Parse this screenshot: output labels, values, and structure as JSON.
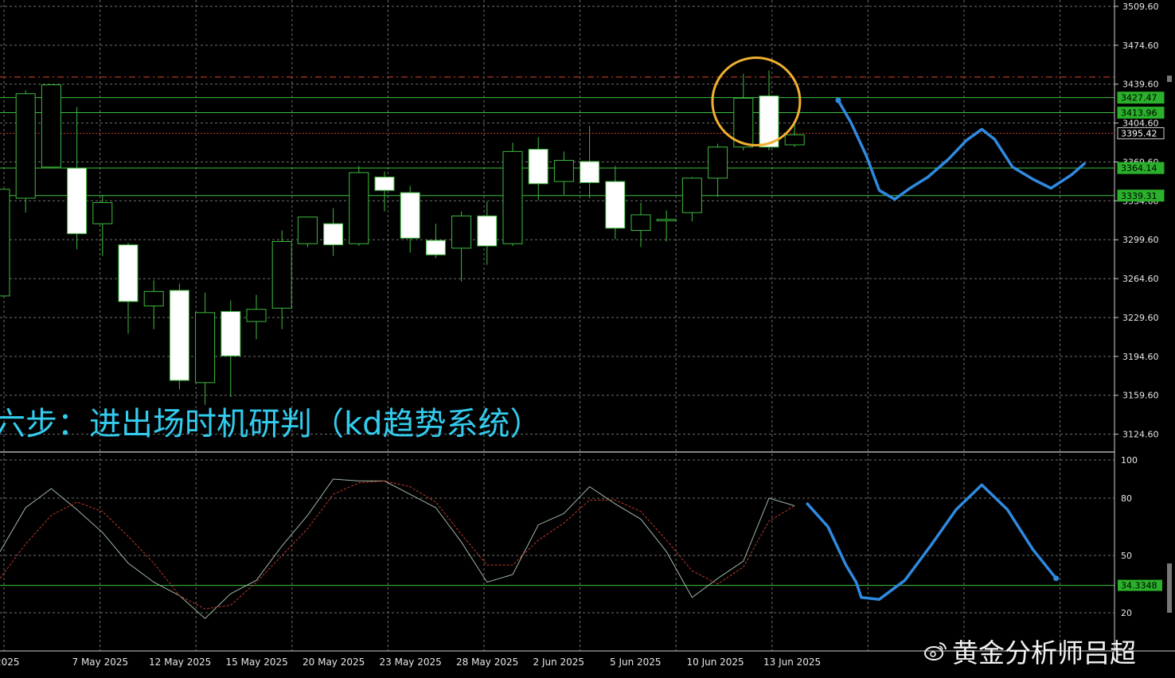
{
  "overlay_title": "六步：进出场时机研判（kd趋势系统）",
  "watermark": "黄金分析师吕超",
  "colors": {
    "background": "#000000",
    "grid": "#6e6e6e",
    "candle_up_fill": "#000000",
    "candle_down_fill": "#ffffff",
    "candle_outline": "#3dbb3d",
    "level_line": "#3cbf3c",
    "resistance_line": "#c03a2a",
    "k_line": "#9fb6a8",
    "d_line": "#c0392b",
    "annotation_blue": "#2f8ae0",
    "circle": "#f0b030",
    "title_text": "#33ccee",
    "axis_text": "#e6e6e6",
    "label_bg": "#2ab02a"
  },
  "icons": [
    "weibo-icon"
  ],
  "chart_data": [
    {
      "type": "candlestick",
      "title": "",
      "ylim": [
        3110,
        3509.6
      ],
      "y_ticks": [
        3509.6,
        3474.6,
        3439.6,
        3404.6,
        3369.6,
        3334.6,
        3299.6,
        3264.6,
        3229.6,
        3194.6,
        3159.6,
        3124.6
      ],
      "x_labels": [
        "2025",
        "7 May 2025",
        "12 May 2025",
        "15 May 2025",
        "20 May 2025",
        "23 May 2025",
        "28 May 2025",
        "2 Jun 2025",
        "5 Jun 2025",
        "10 Jun 2025",
        "13 Jun 2025"
      ],
      "candles": [
        {
          "o": 3249,
          "h": 3345,
          "l": 3249,
          "c": 3345
        },
        {
          "o": 3337,
          "h": 3434,
          "l": 3324,
          "c": 3431
        },
        {
          "o": 3365,
          "h": 3438,
          "l": 3364,
          "c": 3439
        },
        {
          "o": 3364,
          "h": 3419,
          "l": 3291,
          "c": 3305
        },
        {
          "o": 3314,
          "h": 3340,
          "l": 3285,
          "c": 3333
        },
        {
          "o": 3295,
          "h": 3297,
          "l": 3215,
          "c": 3244
        },
        {
          "o": 3240,
          "h": 3263,
          "l": 3219,
          "c": 3253
        },
        {
          "o": 3254,
          "h": 3260,
          "l": 3165,
          "c": 3173
        },
        {
          "o": 3171,
          "h": 3252,
          "l": 3151,
          "c": 3234
        },
        {
          "o": 3235,
          "h": 3245,
          "l": 3158,
          "c": 3195
        },
        {
          "o": 3226,
          "h": 3250,
          "l": 3210,
          "c": 3237
        },
        {
          "o": 3238,
          "h": 3308,
          "l": 3219,
          "c": 3298
        },
        {
          "o": 3296,
          "h": 3320,
          "l": 3293,
          "c": 3320
        },
        {
          "o": 3314,
          "h": 3328,
          "l": 3285,
          "c": 3295
        },
        {
          "o": 3296,
          "h": 3366,
          "l": 3294,
          "c": 3360
        },
        {
          "o": 3356,
          "h": 3361,
          "l": 3325,
          "c": 3344
        },
        {
          "o": 3342,
          "h": 3348,
          "l": 3288,
          "c": 3301
        },
        {
          "o": 3299,
          "h": 3314,
          "l": 3283,
          "c": 3286
        },
        {
          "o": 3292,
          "h": 3325,
          "l": 3262,
          "c": 3321
        },
        {
          "o": 3321,
          "h": 3334,
          "l": 3277,
          "c": 3294
        },
        {
          "o": 3296,
          "h": 3387,
          "l": 3294,
          "c": 3379
        },
        {
          "o": 3381,
          "h": 3392,
          "l": 3335,
          "c": 3350
        },
        {
          "o": 3352,
          "h": 3379,
          "l": 3340,
          "c": 3371
        },
        {
          "o": 3370,
          "h": 3402,
          "l": 3337,
          "c": 3351
        },
        {
          "o": 3352,
          "h": 3366,
          "l": 3300,
          "c": 3310
        },
        {
          "o": 3308,
          "h": 3333,
          "l": 3293,
          "c": 3322
        },
        {
          "o": 3318,
          "h": 3326,
          "l": 3298,
          "c": 3318
        },
        {
          "o": 3324,
          "h": 3356,
          "l": 3316,
          "c": 3355
        },
        {
          "o": 3355,
          "h": 3386,
          "l": 3338,
          "c": 3383
        },
        {
          "o": 3383,
          "h": 3449,
          "l": 3380,
          "c": 3427
        },
        {
          "o": 3429,
          "h": 3452,
          "l": 3380,
          "c": 3383
        },
        {
          "o": 3385,
          "h": 3405,
          "l": 3383,
          "c": 3394
        }
      ],
      "horizontal_lines": [
        {
          "value": 3427.47,
          "label": "3427.47",
          "style": "solid"
        },
        {
          "value": 3413.96,
          "label": "3413.96",
          "style": "solid"
        },
        {
          "value": 3364.14,
          "label": "3364.14",
          "style": "solid"
        },
        {
          "value": 3339.31,
          "label": "3339.31",
          "style": "solid"
        },
        {
          "value": 3395.42,
          "label": "3395.42",
          "style": "current"
        },
        {
          "value": 3446,
          "label": "",
          "style": "dashed"
        }
      ],
      "forecast_path": [
        [
          32.7,
          3425
        ],
        [
          33.2,
          3405
        ],
        [
          33.8,
          3375
        ],
        [
          34.3,
          3344
        ],
        [
          34.9,
          3336
        ],
        [
          35.5,
          3346
        ],
        [
          36.2,
          3356
        ],
        [
          37,
          3372
        ],
        [
          37.7,
          3389
        ],
        [
          38.3,
          3399
        ],
        [
          38.8,
          3390
        ],
        [
          39.5,
          3365
        ],
        [
          40.3,
          3354
        ],
        [
          41,
          3346
        ],
        [
          41.8,
          3358
        ],
        [
          42.3,
          3368
        ]
      ],
      "highlight_circle": {
        "center_index": 29.5,
        "center_value": 3424,
        "label": ""
      }
    },
    {
      "type": "line",
      "title": "",
      "ylim": [
        10,
        100
      ],
      "y_ticks": [
        100,
        80,
        50,
        20
      ],
      "level_line": {
        "value": 34.3348,
        "label": "34.3348"
      },
      "series": [
        {
          "key": "K",
          "values": [
            52,
            75,
            85,
            74,
            62,
            46,
            36,
            29,
            17,
            30,
            37,
            55,
            71,
            90,
            89,
            89,
            82,
            75,
            57,
            36,
            40,
            66,
            72,
            86,
            77,
            69,
            52,
            28,
            38,
            47,
            80,
            76
          ]
        },
        {
          "key": "D",
          "values": [
            38,
            56,
            71,
            78,
            73,
            60,
            46,
            29,
            22,
            24,
            36,
            50,
            64,
            82,
            88,
            89,
            86,
            78,
            61,
            45,
            45,
            58,
            67,
            79,
            79,
            73,
            58,
            42,
            35,
            44,
            68,
            76
          ]
        }
      ],
      "forecast_path": [
        [
          31.5,
          77
        ],
        [
          32.3,
          65
        ],
        [
          33,
          45
        ],
        [
          33.4,
          36
        ],
        [
          33.6,
          28
        ],
        [
          34.3,
          27
        ],
        [
          35.3,
          37
        ],
        [
          36.3,
          55
        ],
        [
          37.3,
          74
        ],
        [
          38.3,
          87
        ],
        [
          39.3,
          74
        ],
        [
          40.3,
          53
        ],
        [
          41.2,
          38
        ]
      ]
    }
  ]
}
